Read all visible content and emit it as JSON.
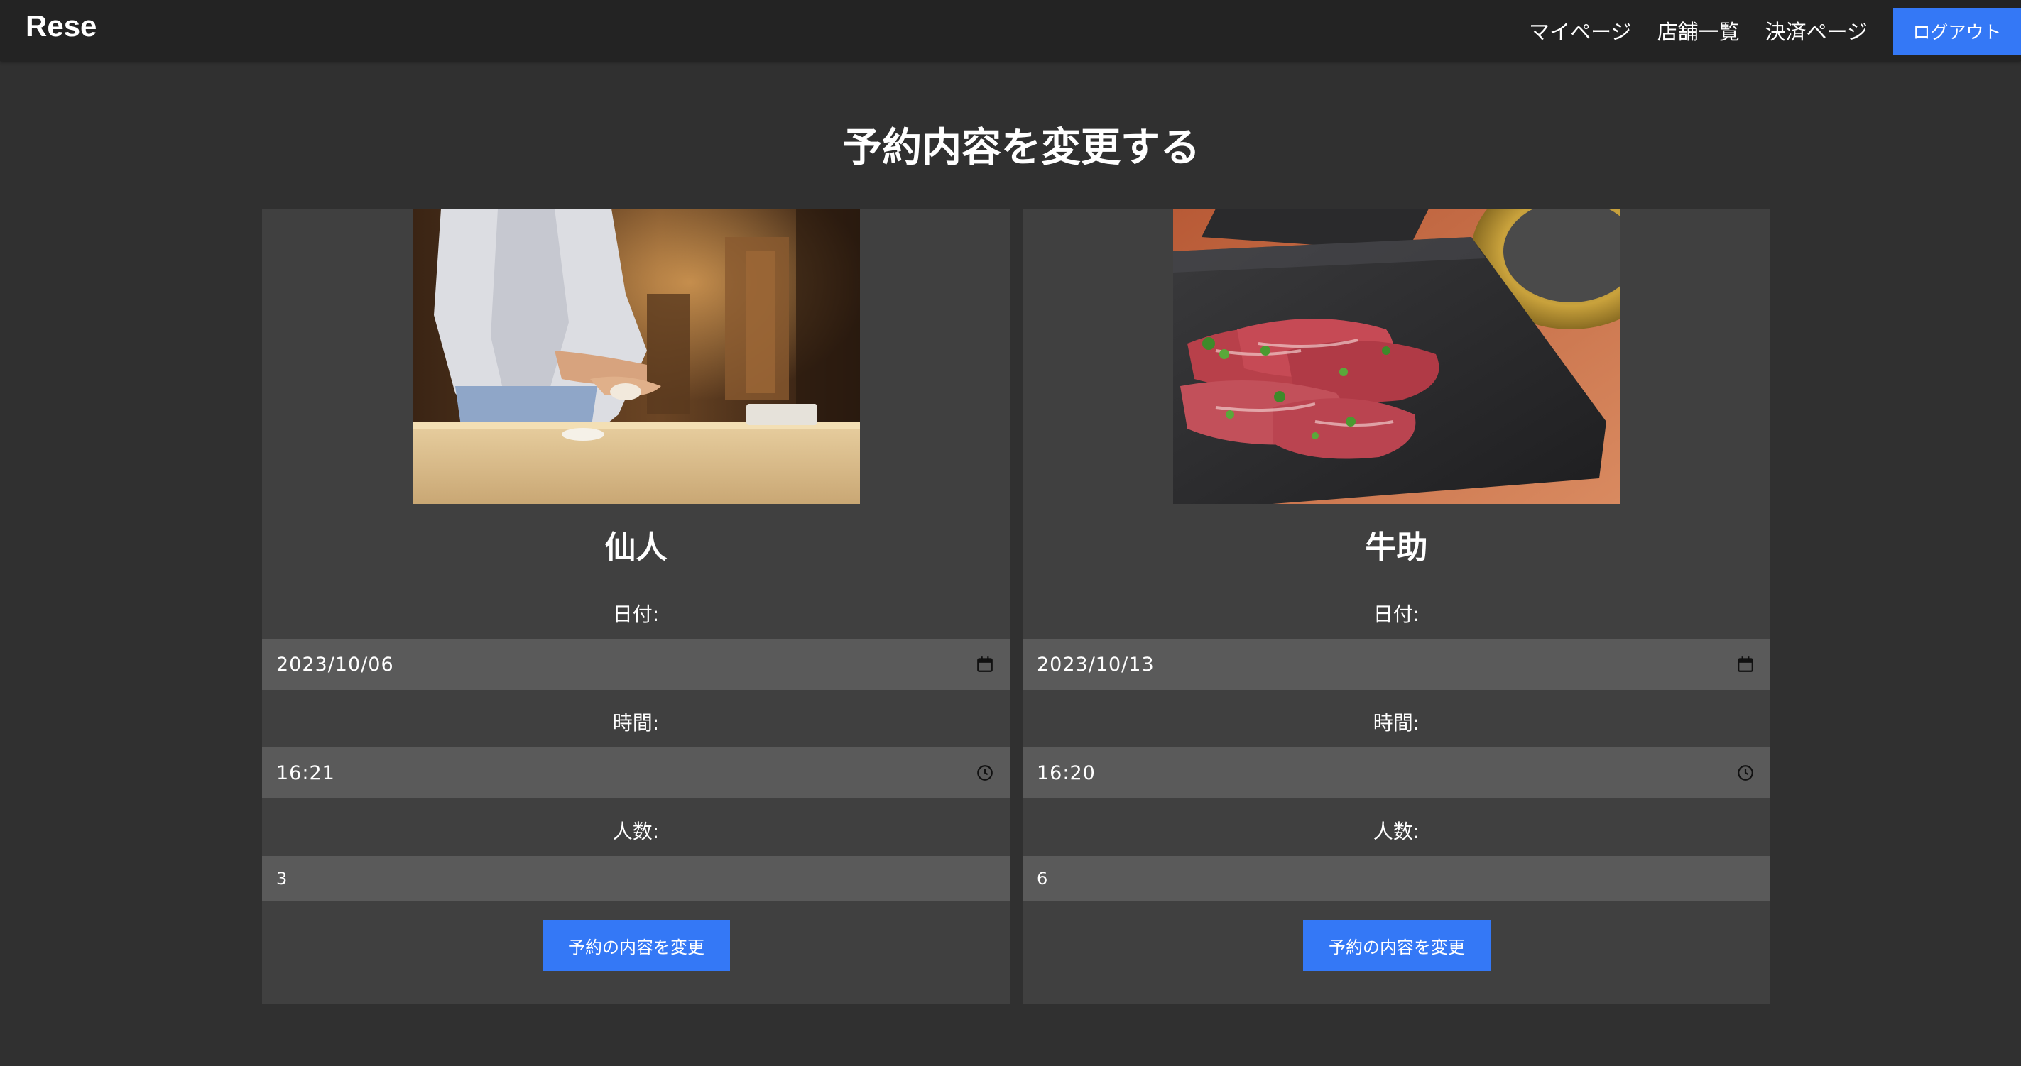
{
  "header": {
    "logo": "Rese",
    "nav": {
      "mypage": "マイページ",
      "shops": "店舗一覧",
      "payment": "決済ページ",
      "logout": "ログアウト"
    }
  },
  "page": {
    "title": "予約内容を変更する"
  },
  "reservations": [
    {
      "shop_name": "仙人",
      "image": "sushi-chef-photo",
      "date_label": "日付:",
      "date_value": "2023/10/06",
      "time_label": "時間:",
      "time_value": "16:21",
      "people_label": "人数:",
      "people_value": "3",
      "submit_label": "予約の内容を変更"
    },
    {
      "shop_name": "牛助",
      "image": "yakiniku-beef-photo",
      "date_label": "日付:",
      "date_value": "2023/10/13",
      "time_label": "時間:",
      "time_value": "16:20",
      "people_label": "人数:",
      "people_value": "6",
      "submit_label": "予約の内容を変更"
    }
  ],
  "colors": {
    "page_bg": "#303030",
    "header_bg": "#232323",
    "card_bg": "#404040",
    "field_bg": "#5a5a5a",
    "accent": "#3478f6"
  },
  "icons": {
    "date": "calendar-icon",
    "time": "clock-icon"
  }
}
